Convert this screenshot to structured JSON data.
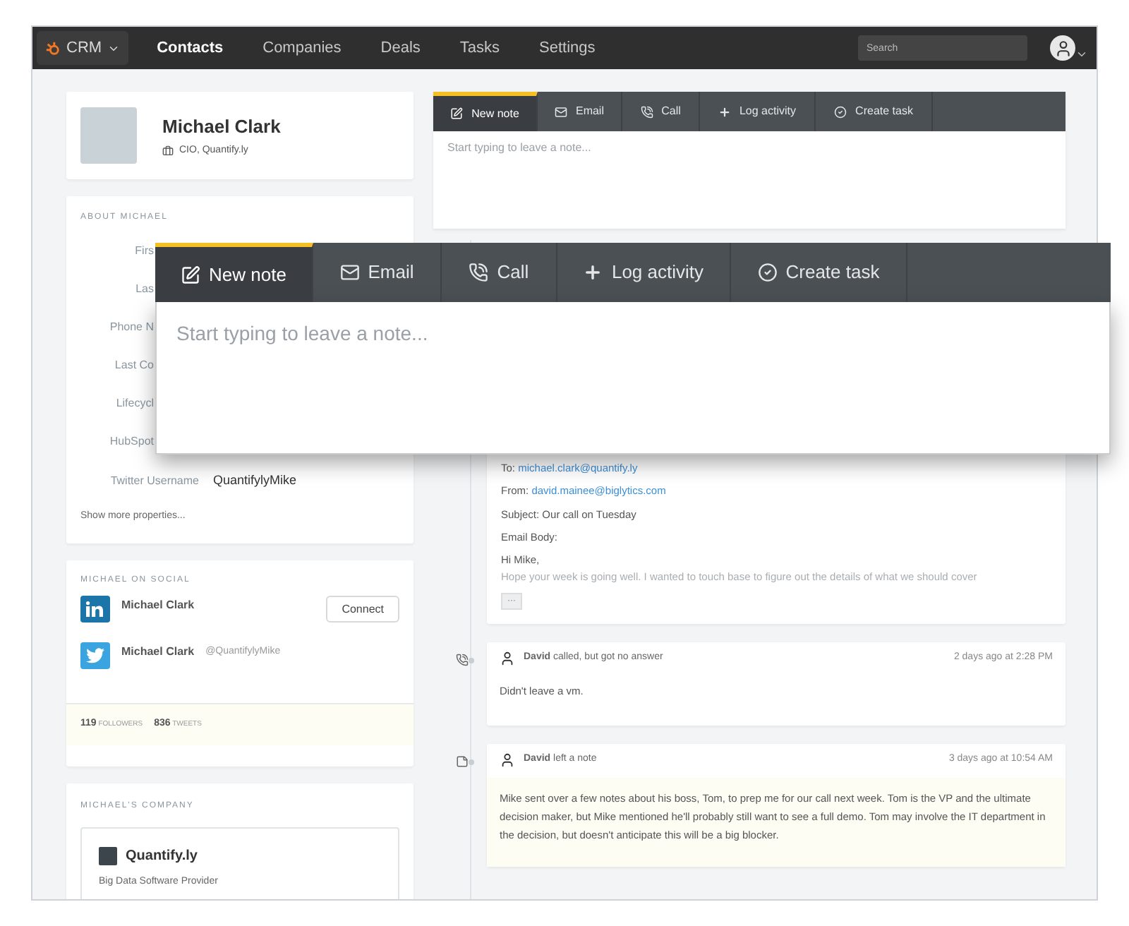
{
  "nav": {
    "brand": "CRM",
    "links": [
      {
        "label": "Contacts",
        "selected": true
      },
      {
        "label": "Companies",
        "selected": false
      },
      {
        "label": "Deals",
        "selected": false
      },
      {
        "label": "Tasks",
        "selected": false
      },
      {
        "label": "Settings",
        "selected": false
      }
    ],
    "search": {
      "placeholder": "Search"
    }
  },
  "profile": {
    "name": "Michael Clark",
    "title": "CIO, Quantify.ly"
  },
  "about": {
    "heading": "ABOUT MICHAEL",
    "rows": [
      {
        "kind": "cut",
        "label": "Firs"
      },
      {
        "kind": "cut",
        "label": "Las"
      },
      {
        "kind": "cut",
        "label": "Phone N"
      },
      {
        "kind": "cut",
        "label": "Last Co"
      },
      {
        "kind": "cut",
        "label": "Lifecycl"
      },
      {
        "kind": "cut",
        "label": "HubSpot"
      },
      {
        "kind": "full",
        "label": "Twitter Username",
        "value": "QuantifylyMike"
      }
    ],
    "more": "Show more properties..."
  },
  "social": {
    "heading": "MICHAEL ON SOCIAL",
    "accounts": [
      {
        "kind": "linkedin",
        "name": "Michael Clark",
        "action": "Connect"
      },
      {
        "kind": "twitter",
        "name": "Michael Clark",
        "handle": "@QuantifylyMike"
      }
    ],
    "stats": [
      {
        "count": "119",
        "label": "FOLLOWERS"
      },
      {
        "count": "836",
        "label": "TWEETS"
      }
    ]
  },
  "company": {
    "heading": "MICHAEL'S COMPANY",
    "name": "Quantify.ly",
    "description": "Big Data Software Provider"
  },
  "composer": {
    "tabs": [
      {
        "kind": "note",
        "label": "New note",
        "selected": true
      },
      {
        "kind": "email",
        "label": "Email",
        "selected": false
      },
      {
        "kind": "call",
        "label": "Call",
        "selected": false
      },
      {
        "kind": "log",
        "label": "Log activity",
        "selected": false
      },
      {
        "kind": "task",
        "label": "Create task",
        "selected": false
      }
    ],
    "placeholder": "Start typing to leave a note..."
  },
  "composer_zoomed": {
    "tabs": [
      {
        "kind": "note",
        "label": "New note",
        "selected": true
      },
      {
        "kind": "email",
        "label": "Email",
        "selected": false
      },
      {
        "kind": "call",
        "label": "Call",
        "selected": false
      },
      {
        "kind": "log",
        "label": "Log activity",
        "selected": false
      },
      {
        "kind": "task",
        "label": "Create task",
        "selected": false
      }
    ],
    "placeholder": "Start typing to leave a note..."
  },
  "timeline": [
    {
      "kind": "email",
      "fields": [
        {
          "label": "To:",
          "value": "michael.clark@quantify.ly"
        },
        {
          "label": "From:",
          "value": "david.mainee@biglytics.com"
        }
      ],
      "subject": "Subject: Our call on Tuesday",
      "body_label": "Email Body:",
      "greeting": "Hi Mike,",
      "preview": "Hope your week is going well. I wanted to touch base to figure out the details of what we should cover",
      "more": "···"
    },
    {
      "kind": "call",
      "summary": "**David** called, but got no answer",
      "time": "2 days ago at 2:28 PM",
      "body": "Didn't leave a vm."
    },
    {
      "kind": "note",
      "summary": "**David** left a note",
      "time": "3 days ago at 10:54 AM",
      "body": "Mike sent over a few notes about his boss, Tom, to prep me for our call next week. Tom is the VP and the ultimate decision maker, but Mike mentioned he'll probably still want to see a full demo. Tom may involve the IT department in the decision, but doesn't anticipate this will be a big blocker."
    }
  ]
}
